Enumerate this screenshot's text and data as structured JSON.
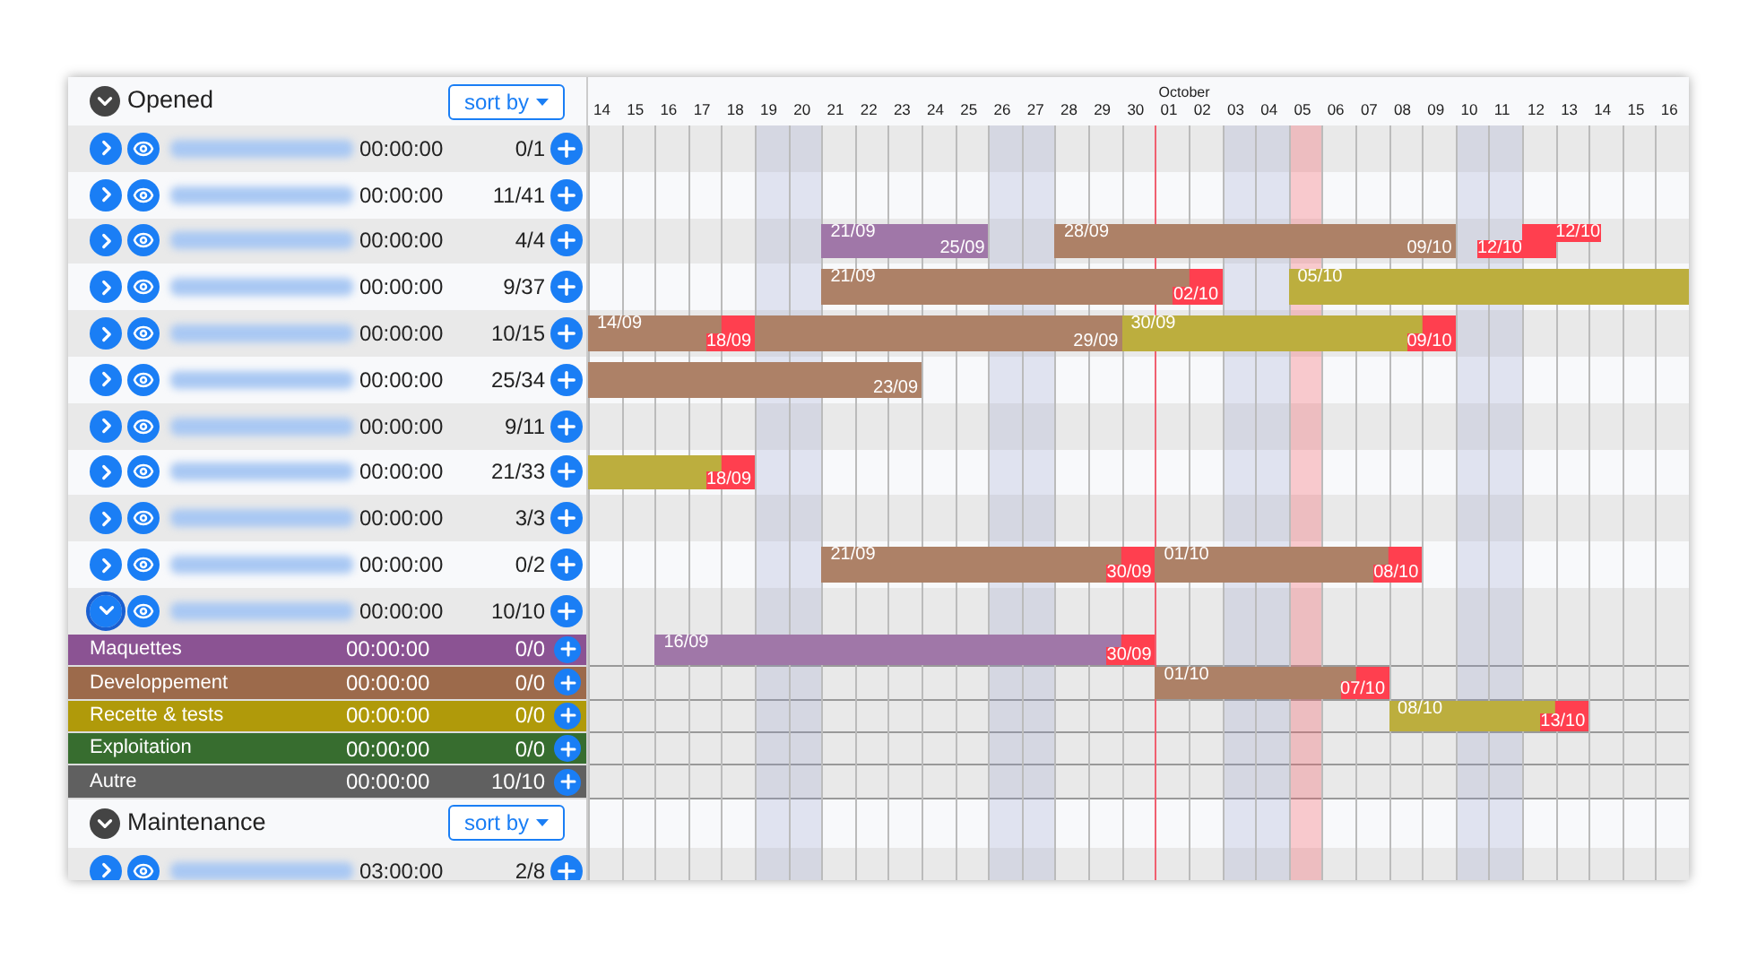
{
  "days": [
    {
      "label": "14",
      "weekend": false,
      "today": false
    },
    {
      "label": "15",
      "weekend": false,
      "today": false
    },
    {
      "label": "16",
      "weekend": false,
      "today": false
    },
    {
      "label": "17",
      "weekend": false,
      "today": false
    },
    {
      "label": "18",
      "weekend": false,
      "today": false
    },
    {
      "label": "19",
      "weekend": true,
      "today": false
    },
    {
      "label": "20",
      "weekend": true,
      "today": false
    },
    {
      "label": "21",
      "weekend": false,
      "today": false
    },
    {
      "label": "22",
      "weekend": false,
      "today": false
    },
    {
      "label": "23",
      "weekend": false,
      "today": false
    },
    {
      "label": "24",
      "weekend": false,
      "today": false
    },
    {
      "label": "25",
      "weekend": false,
      "today": false
    },
    {
      "label": "26",
      "weekend": true,
      "today": false
    },
    {
      "label": "27",
      "weekend": true,
      "today": false
    },
    {
      "label": "28",
      "weekend": false,
      "today": false
    },
    {
      "label": "29",
      "weekend": false,
      "today": false
    },
    {
      "label": "30",
      "weekend": false,
      "today": false
    },
    {
      "label": "01",
      "month": "October",
      "weekend": false,
      "today": false
    },
    {
      "label": "02",
      "weekend": false,
      "today": false
    },
    {
      "label": "03",
      "weekend": true,
      "today": false
    },
    {
      "label": "04",
      "weekend": true,
      "today": false
    },
    {
      "label": "05",
      "weekend": false,
      "today": true
    },
    {
      "label": "06",
      "weekend": false,
      "today": false
    },
    {
      "label": "07",
      "weekend": false,
      "today": false
    },
    {
      "label": "08",
      "weekend": false,
      "today": false
    },
    {
      "label": "09",
      "weekend": false,
      "today": false
    },
    {
      "label": "10",
      "weekend": true,
      "today": false
    },
    {
      "label": "11",
      "weekend": true,
      "today": false
    },
    {
      "label": "12",
      "weekend": false,
      "today": false
    },
    {
      "label": "13",
      "weekend": false,
      "today": false
    },
    {
      "label": "14",
      "weekend": false,
      "today": false
    },
    {
      "label": "15",
      "weekend": false,
      "today": false
    },
    {
      "label": "16",
      "weekend": false,
      "today": false
    }
  ],
  "sections": [
    {
      "title": "Opened",
      "expanded": true,
      "sort_label": "sort by",
      "projects": [
        {
          "expanded": false,
          "time": "00:00:00",
          "count": "0/1"
        },
        {
          "expanded": false,
          "time": "00:00:00",
          "count": "11/41"
        },
        {
          "expanded": false,
          "time": "00:00:00",
          "count": "4/4",
          "bars": [
            {
              "start": "21/09",
              "end": "25/09",
              "color": "#a077a8",
              "overdue": false
            },
            {
              "start": "28/09",
              "end": "09/10",
              "color": "#ad8167",
              "overdue": false
            },
            {
              "start": "12/10",
              "end": "12/10",
              "color": "#ff3f4f",
              "overdue": true
            }
          ]
        },
        {
          "expanded": false,
          "time": "00:00:00",
          "count": "9/37",
          "bars": [
            {
              "start": "21/09",
              "end": "02/10",
              "color": "#ad8167",
              "overdue": true
            },
            {
              "start": "05/10",
              "color": "#bcae3e"
            }
          ]
        },
        {
          "expanded": false,
          "time": "00:00:00",
          "count": "10/15",
          "bars": [
            {
              "start": "14/09",
              "end": "18/09",
              "color": "#ad8167",
              "overdue": true
            },
            {
              "end": "29/09",
              "color": "#ad8167",
              "overdue": false
            },
            {
              "start": "30/09",
              "end": "09/10",
              "color": "#bcae3e",
              "overdue": true
            }
          ]
        },
        {
          "expanded": false,
          "time": "00:00:00",
          "count": "25/34",
          "bars": [
            {
              "end": "23/09",
              "color": "#ad8167",
              "overdue": false
            }
          ]
        },
        {
          "expanded": false,
          "time": "00:00:00",
          "count": "9/11"
        },
        {
          "expanded": false,
          "time": "00:00:00",
          "count": "21/33",
          "bars": [
            {
              "end": "18/09",
              "color": "#bcae3e",
              "overdue": true
            }
          ]
        },
        {
          "expanded": false,
          "time": "00:00:00",
          "count": "3/3"
        },
        {
          "expanded": false,
          "time": "00:00:00",
          "count": "0/2",
          "bars": [
            {
              "start": "21/09",
              "end": "30/09",
              "color": "#ad8167",
              "overdue": true
            },
            {
              "start": "01/10",
              "end": "08/10",
              "color": "#ad8167",
              "overdue": true
            }
          ]
        },
        {
          "expanded": true,
          "time": "00:00:00",
          "count": "10/10",
          "tasks": [
            {
              "name": "Maquettes",
              "color": "#8b5393",
              "time": "00:00:00",
              "count": "0/0",
              "bars": [
                {
                  "start": "16/09",
                  "end": "30/09",
                  "color": "#a077a8",
                  "overdue": true
                }
              ]
            },
            {
              "name": "Developpement",
              "color": "#9c6a4b",
              "time": "00:00:00",
              "count": "0/0",
              "bars": [
                {
                  "start": "01/10",
                  "end": "07/10",
                  "color": "#ad8167",
                  "overdue": true
                }
              ]
            },
            {
              "name": "Recette & tests",
              "color": "#b09a0a",
              "time": "00:00:00",
              "count": "0/0",
              "bars": [
                {
                  "start": "08/10",
                  "end": "13/10",
                  "color": "#bcae3e",
                  "overdue": true
                }
              ]
            },
            {
              "name": "Exploitation",
              "color": "#376d2f",
              "time": "00:00:00",
              "count": "0/0"
            },
            {
              "name": "Autre",
              "color": "#606060",
              "time": "00:00:00",
              "count": "10/10"
            }
          ]
        }
      ]
    },
    {
      "title": "Maintenance",
      "expanded": true,
      "sort_label": "sort by",
      "projects": [
        {
          "expanded": false,
          "time": "03:00:00",
          "count": "2/8"
        }
      ]
    }
  ]
}
